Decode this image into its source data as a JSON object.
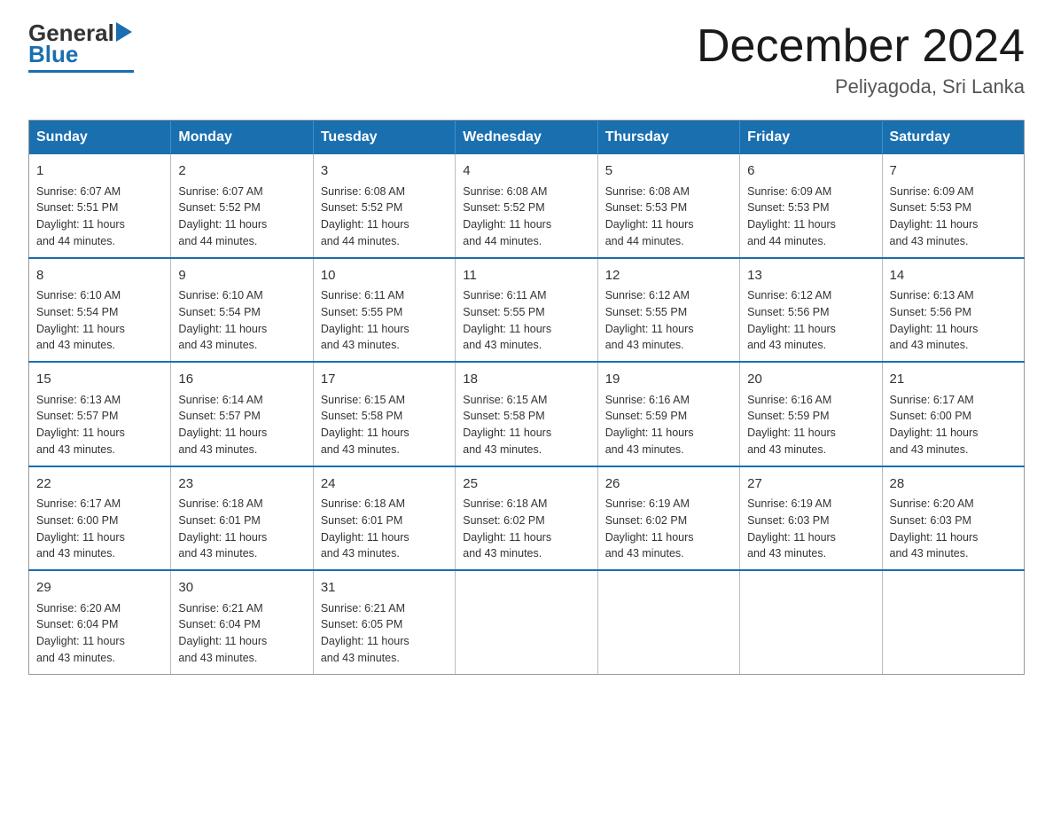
{
  "logo": {
    "text_general": "General",
    "text_blue": "Blue"
  },
  "header": {
    "month": "December 2024",
    "location": "Peliyagoda, Sri Lanka"
  },
  "weekdays": [
    "Sunday",
    "Monday",
    "Tuesday",
    "Wednesday",
    "Thursday",
    "Friday",
    "Saturday"
  ],
  "weeks": [
    [
      {
        "day": 1,
        "sunrise": "6:07 AM",
        "sunset": "5:51 PM",
        "daylight": "11 hours and 44 minutes."
      },
      {
        "day": 2,
        "sunrise": "6:07 AM",
        "sunset": "5:52 PM",
        "daylight": "11 hours and 44 minutes."
      },
      {
        "day": 3,
        "sunrise": "6:08 AM",
        "sunset": "5:52 PM",
        "daylight": "11 hours and 44 minutes."
      },
      {
        "day": 4,
        "sunrise": "6:08 AM",
        "sunset": "5:52 PM",
        "daylight": "11 hours and 44 minutes."
      },
      {
        "day": 5,
        "sunrise": "6:08 AM",
        "sunset": "5:53 PM",
        "daylight": "11 hours and 44 minutes."
      },
      {
        "day": 6,
        "sunrise": "6:09 AM",
        "sunset": "5:53 PM",
        "daylight": "11 hours and 44 minutes."
      },
      {
        "day": 7,
        "sunrise": "6:09 AM",
        "sunset": "5:53 PM",
        "daylight": "11 hours and 43 minutes."
      }
    ],
    [
      {
        "day": 8,
        "sunrise": "6:10 AM",
        "sunset": "5:54 PM",
        "daylight": "11 hours and 43 minutes."
      },
      {
        "day": 9,
        "sunrise": "6:10 AM",
        "sunset": "5:54 PM",
        "daylight": "11 hours and 43 minutes."
      },
      {
        "day": 10,
        "sunrise": "6:11 AM",
        "sunset": "5:55 PM",
        "daylight": "11 hours and 43 minutes."
      },
      {
        "day": 11,
        "sunrise": "6:11 AM",
        "sunset": "5:55 PM",
        "daylight": "11 hours and 43 minutes."
      },
      {
        "day": 12,
        "sunrise": "6:12 AM",
        "sunset": "5:55 PM",
        "daylight": "11 hours and 43 minutes."
      },
      {
        "day": 13,
        "sunrise": "6:12 AM",
        "sunset": "5:56 PM",
        "daylight": "11 hours and 43 minutes."
      },
      {
        "day": 14,
        "sunrise": "6:13 AM",
        "sunset": "5:56 PM",
        "daylight": "11 hours and 43 minutes."
      }
    ],
    [
      {
        "day": 15,
        "sunrise": "6:13 AM",
        "sunset": "5:57 PM",
        "daylight": "11 hours and 43 minutes."
      },
      {
        "day": 16,
        "sunrise": "6:14 AM",
        "sunset": "5:57 PM",
        "daylight": "11 hours and 43 minutes."
      },
      {
        "day": 17,
        "sunrise": "6:15 AM",
        "sunset": "5:58 PM",
        "daylight": "11 hours and 43 minutes."
      },
      {
        "day": 18,
        "sunrise": "6:15 AM",
        "sunset": "5:58 PM",
        "daylight": "11 hours and 43 minutes."
      },
      {
        "day": 19,
        "sunrise": "6:16 AM",
        "sunset": "5:59 PM",
        "daylight": "11 hours and 43 minutes."
      },
      {
        "day": 20,
        "sunrise": "6:16 AM",
        "sunset": "5:59 PM",
        "daylight": "11 hours and 43 minutes."
      },
      {
        "day": 21,
        "sunrise": "6:17 AM",
        "sunset": "6:00 PM",
        "daylight": "11 hours and 43 minutes."
      }
    ],
    [
      {
        "day": 22,
        "sunrise": "6:17 AM",
        "sunset": "6:00 PM",
        "daylight": "11 hours and 43 minutes."
      },
      {
        "day": 23,
        "sunrise": "6:18 AM",
        "sunset": "6:01 PM",
        "daylight": "11 hours and 43 minutes."
      },
      {
        "day": 24,
        "sunrise": "6:18 AM",
        "sunset": "6:01 PM",
        "daylight": "11 hours and 43 minutes."
      },
      {
        "day": 25,
        "sunrise": "6:18 AM",
        "sunset": "6:02 PM",
        "daylight": "11 hours and 43 minutes."
      },
      {
        "day": 26,
        "sunrise": "6:19 AM",
        "sunset": "6:02 PM",
        "daylight": "11 hours and 43 minutes."
      },
      {
        "day": 27,
        "sunrise": "6:19 AM",
        "sunset": "6:03 PM",
        "daylight": "11 hours and 43 minutes."
      },
      {
        "day": 28,
        "sunrise": "6:20 AM",
        "sunset": "6:03 PM",
        "daylight": "11 hours and 43 minutes."
      }
    ],
    [
      {
        "day": 29,
        "sunrise": "6:20 AM",
        "sunset": "6:04 PM",
        "daylight": "11 hours and 43 minutes."
      },
      {
        "day": 30,
        "sunrise": "6:21 AM",
        "sunset": "6:04 PM",
        "daylight": "11 hours and 43 minutes."
      },
      {
        "day": 31,
        "sunrise": "6:21 AM",
        "sunset": "6:05 PM",
        "daylight": "11 hours and 43 minutes."
      },
      null,
      null,
      null,
      null
    ]
  ]
}
